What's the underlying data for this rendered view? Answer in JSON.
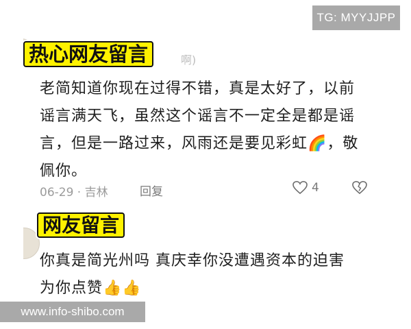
{
  "watermark_top": "TG: MYYJJPP",
  "watermark_bottom": "www.info-shibo.com",
  "comment1": {
    "stamp_label": "热心网友留言",
    "partial_username": "啊)",
    "text": "老简知道你现在过得不错，真是太好了，以前谣言满天飞，虽然这个谣言不一定全是都是谣言，但是一路过来，风雨还是要见彩虹🌈，敬佩你。",
    "date": "06-29 · 吉林",
    "reply_label": "回复",
    "like_count": "4"
  },
  "comment2": {
    "stamp_label": "网友留言",
    "text": "你真是简光州吗 真庆幸你没遭遇资本的迫害 为你点赞👍👍"
  },
  "icons": {
    "like": "heart-outline-icon",
    "dislike": "broken-heart-icon"
  }
}
